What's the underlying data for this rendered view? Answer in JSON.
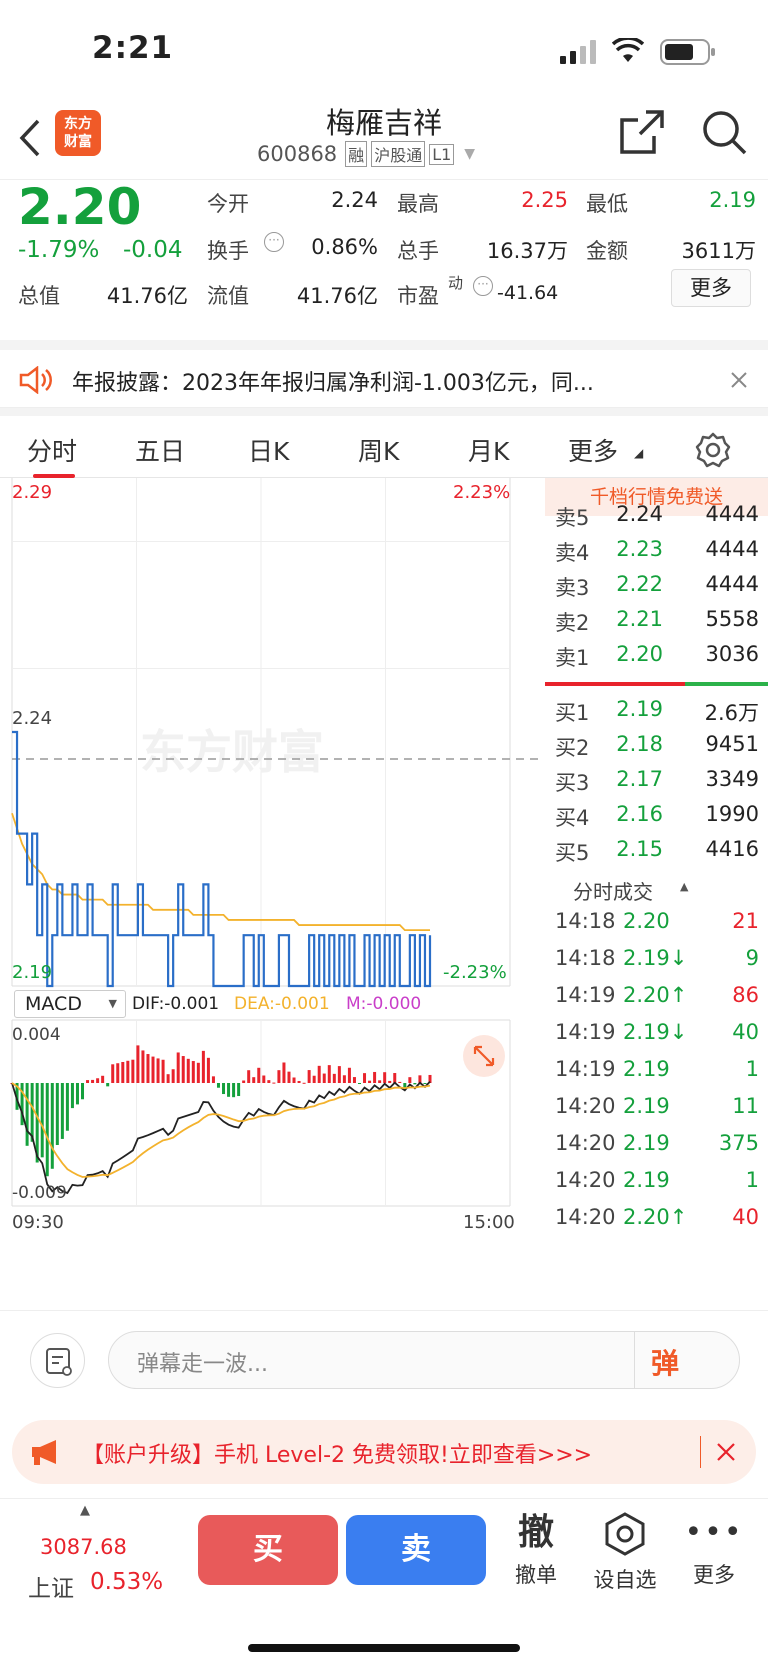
{
  "status": {
    "time": "2:21"
  },
  "header": {
    "logo": "东方\n财富",
    "title": "梅雁吉祥",
    "code": "600868",
    "tags": [
      "融",
      "沪股通",
      "L1"
    ]
  },
  "quote": {
    "price": "2.20",
    "pct": "-1.79%",
    "chg": "-0.04",
    "open_l": "今开",
    "open_v": "2.24",
    "high_l": "最高",
    "high_v": "2.25",
    "low_l": "最低",
    "low_v": "2.19",
    "turn_l": "换手",
    "turn_v": "0.86%",
    "vol_l": "总手",
    "vol_v": "16.37万",
    "amt_l": "金额",
    "amt_v": "3611万",
    "cap_l": "总值",
    "cap_v": "41.76亿",
    "fcap_l": "流值",
    "fcap_v": "41.76亿",
    "pe_l": "市盈",
    "pe_sup": "动",
    "pe_v": "-41.64",
    "more": "更多"
  },
  "news": {
    "text": "年报披露：2023年年报归属净利润-1.003亿元，同..."
  },
  "tabs": [
    "分时",
    "五日",
    "日K",
    "周K",
    "月K",
    "更多"
  ],
  "chart": {
    "ymax": "2.29",
    "ymid": "2.24",
    "ymin": "2.19",
    "pmax": "2.23%",
    "pmin": "-2.23%",
    "watermark": "东方财富",
    "t_start": "09:30",
    "t_end": "15:00",
    "macd_sel": "MACD",
    "dif": "DIF:-0.001",
    "dea": "DEA:-0.001",
    "m": "M:-0.000",
    "macd_max": "0.004",
    "macd_min": "-0.009"
  },
  "chart_data": {
    "type": "line",
    "x_range": [
      "09:30",
      "15:00"
    ],
    "ylim": [
      2.19,
      2.29
    ],
    "ref_price": 2.24,
    "series": [
      {
        "name": "price",
        "values": [
          2.24,
          2.22,
          2.22,
          2.21,
          2.22,
          2.2,
          2.21,
          2.19,
          2.2,
          2.21,
          2.2,
          2.2,
          2.21,
          2.2,
          2.2,
          2.21,
          2.2,
          2.2,
          2.2,
          2.19,
          2.21,
          2.2,
          2.2,
          2.2,
          2.2,
          2.21,
          2.2,
          2.2,
          2.2,
          2.2,
          2.2,
          2.19,
          2.2,
          2.21,
          2.2,
          2.2,
          2.2,
          2.2,
          2.21,
          2.2,
          2.19,
          2.19,
          2.19,
          2.19,
          2.19,
          2.19,
          2.2,
          2.2,
          2.19,
          2.2,
          2.19,
          2.19,
          2.19,
          2.2,
          2.2,
          2.19,
          2.19,
          2.19,
          2.19,
          2.2,
          2.19,
          2.2,
          2.19,
          2.2,
          2.19,
          2.2,
          2.19,
          2.2,
          2.19,
          2.19,
          2.2,
          2.19,
          2.2,
          2.19,
          2.2,
          2.19,
          2.2,
          2.19,
          2.19,
          2.2,
          2.19,
          2.2,
          2.19,
          2.2
        ]
      },
      {
        "name": "avg",
        "values": [
          2.224,
          2.221,
          2.218,
          2.216,
          2.214,
          2.213,
          2.212,
          2.21,
          2.209,
          2.209,
          2.208,
          2.208,
          2.208,
          2.208,
          2.207,
          2.207,
          2.207,
          2.207,
          2.207,
          2.206,
          2.206,
          2.206,
          2.206,
          2.206,
          2.206,
          2.206,
          2.206,
          2.206,
          2.205,
          2.205,
          2.205,
          2.205,
          2.205,
          2.205,
          2.205,
          2.205,
          2.204,
          2.204,
          2.204,
          2.204,
          2.204,
          2.204,
          2.204,
          2.203,
          2.203,
          2.203,
          2.203,
          2.203,
          2.203,
          2.203,
          2.203,
          2.203,
          2.203,
          2.203,
          2.203,
          2.203,
          2.203,
          2.202,
          2.202,
          2.202,
          2.202,
          2.202,
          2.202,
          2.202,
          2.202,
          2.202,
          2.202,
          2.202,
          2.202,
          2.202,
          2.202,
          2.202,
          2.202,
          2.202,
          2.202,
          2.202,
          2.202,
          2.202,
          2.201,
          2.201,
          2.201,
          2.201,
          2.201,
          2.201
        ]
      }
    ]
  },
  "orderbook": {
    "header": "千档行情免费送",
    "asks": [
      {
        "l": "卖5",
        "p": "2.24",
        "v": "4444",
        "c": "dark"
      },
      {
        "l": "卖4",
        "p": "2.23",
        "v": "4444",
        "c": "green"
      },
      {
        "l": "卖3",
        "p": "2.22",
        "v": "4444",
        "c": "green"
      },
      {
        "l": "卖2",
        "p": "2.21",
        "v": "5558",
        "c": "green"
      },
      {
        "l": "卖1",
        "p": "2.20",
        "v": "3036",
        "c": "green"
      }
    ],
    "bids": [
      {
        "l": "买1",
        "p": "2.19",
        "v": "2.6万",
        "c": "green"
      },
      {
        "l": "买2",
        "p": "2.18",
        "v": "9451",
        "c": "green"
      },
      {
        "l": "买3",
        "p": "2.17",
        "v": "3349",
        "c": "green"
      },
      {
        "l": "买4",
        "p": "2.16",
        "v": "1990",
        "c": "green"
      },
      {
        "l": "买5",
        "p": "2.15",
        "v": "4416",
        "c": "green"
      }
    ],
    "trades_title": "分时成交",
    "trades": [
      {
        "t": "14:18",
        "p": "2.20",
        "v": "21",
        "c": "green",
        "vc": "red"
      },
      {
        "t": "14:18",
        "p": "2.19↓",
        "v": "9",
        "c": "green",
        "vc": "green"
      },
      {
        "t": "14:19",
        "p": "2.20↑",
        "v": "86",
        "c": "green",
        "vc": "red"
      },
      {
        "t": "14:19",
        "p": "2.19↓",
        "v": "40",
        "c": "green",
        "vc": "green"
      },
      {
        "t": "14:19",
        "p": "2.19",
        "v": "1",
        "c": "green",
        "vc": "green"
      },
      {
        "t": "14:20",
        "p": "2.19",
        "v": "11",
        "c": "green",
        "vc": "green"
      },
      {
        "t": "14:20",
        "p": "2.19",
        "v": "375",
        "c": "green",
        "vc": "green"
      },
      {
        "t": "14:20",
        "p": "2.19",
        "v": "1",
        "c": "green",
        "vc": "green"
      },
      {
        "t": "14:20",
        "p": "2.20↑",
        "v": "40",
        "c": "green",
        "vc": "red"
      }
    ]
  },
  "comment": {
    "placeholder": "弹幕走一波...",
    "dan": "弹"
  },
  "banner": {
    "text": "【账户升级】手机 Level-2 免费领取!立即查看>>>"
  },
  "bottom": {
    "index_val": "3087.68",
    "index_name": "上证",
    "index_pct": "0.53%",
    "buy": "买",
    "sell": "卖",
    "cancel_icon": "撤",
    "cancel": "撤单",
    "fav": "设自选",
    "more": "更多"
  }
}
